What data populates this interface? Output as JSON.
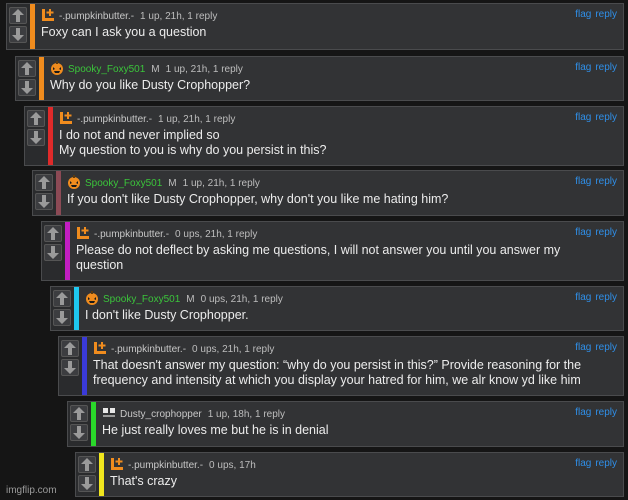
{
  "comments": [
    {
      "username": "-.pumpkinbutter.-",
      "mod": "",
      "meta": "1 up, 21h, 1 reply",
      "text": "Foxy can I ask you a question",
      "avatar": "pumpkinbutter-avatar",
      "bar_color": "#f08c1e"
    },
    {
      "username": "Spooky_Foxy501",
      "mod": "M",
      "meta": "1 up, 21h, 1 reply",
      "text": "Why do you like Dusty Crophopper?",
      "avatar": "spooky-foxy-avatar",
      "bar_color": "#f08c1e"
    },
    {
      "username": "-.pumpkinbutter.-",
      "mod": "",
      "meta": "1 up, 21h, 1 reply",
      "text": "I do not and never implied so",
      "text2": "My question to you is why do you persist in this?",
      "avatar": "pumpkinbutter-avatar",
      "bar_color": "#e02a2a"
    },
    {
      "username": "Spooky_Foxy501",
      "mod": "M",
      "meta": "1 up, 21h, 1 reply",
      "text": "If you don't like Dusty Crophopper, why don't you like me hating him?",
      "avatar": "spooky-foxy-avatar",
      "bar_color": "#8c4a55"
    },
    {
      "username": "-.pumpkinbutter.-",
      "mod": "",
      "meta": "0 ups, 21h, 1 reply",
      "text": "Please do not deflect by asking me questions, I will not answer you until you answer my",
      "text2": "question",
      "avatar": "pumpkinbutter-avatar",
      "bar_color": "#c21ec2"
    },
    {
      "username": "Spooky_Foxy501",
      "mod": "M",
      "meta": "0 ups, 21h, 1 reply",
      "text": "I don't like Dusty Crophopper.",
      "avatar": "spooky-foxy-avatar",
      "bar_color": "#1ec8f0"
    },
    {
      "username": "-.pumpkinbutter.-",
      "mod": "",
      "meta": "0 ups, 21h, 1 reply",
      "text": "That doesn't answer my question: “why do you persist in this?” Provide reasoning for the",
      "text2": "frequency and intensity at which you display your hatred for him, we alr know yd like him",
      "avatar": "pumpkinbutter-avatar",
      "bar_color": "#3a3ad8"
    },
    {
      "username": "Dusty_crophopper",
      "mod": "",
      "meta": "1 up, 18h, 1 reply",
      "text": "He just really loves me but he is in denial",
      "avatar": "dusty-avatar",
      "bar_color": "#2ad82a"
    },
    {
      "username": "-.pumpkinbutter.-",
      "mod": "",
      "meta": "0 ups, 17h",
      "text": "That's crazy",
      "avatar": "pumpkinbutter-avatar",
      "bar_color": "#f0e61e"
    }
  ],
  "actions": {
    "flag": "flag",
    "reply": "reply"
  },
  "watermark": "imgflip.com"
}
